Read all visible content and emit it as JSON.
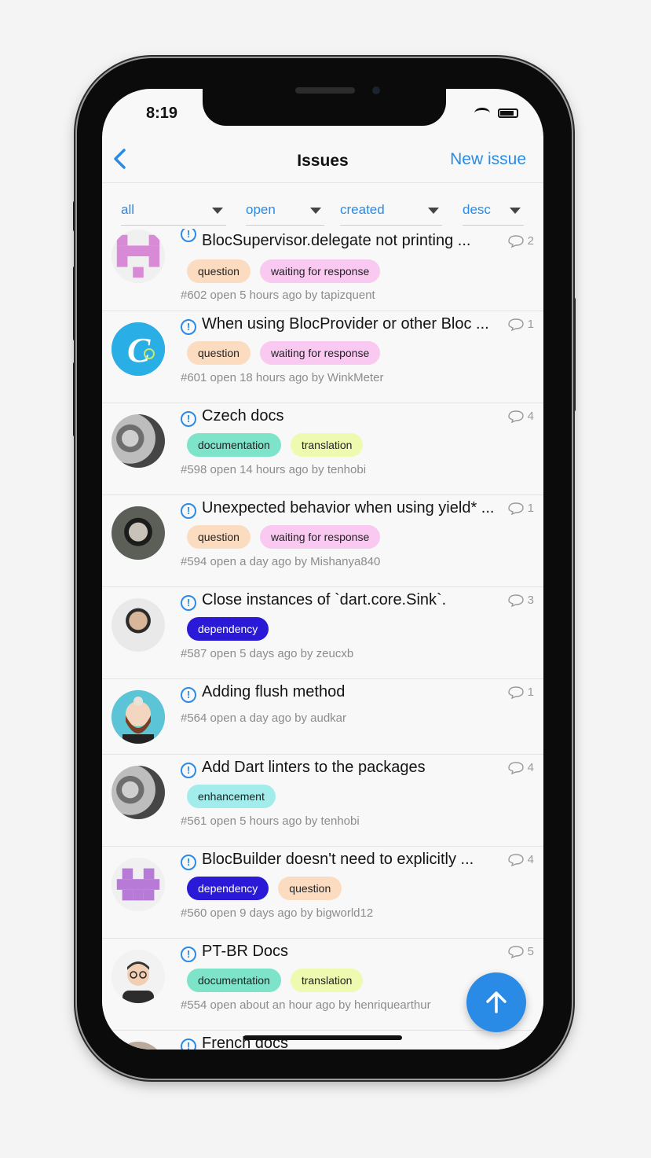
{
  "status": {
    "time": "8:19"
  },
  "navbar": {
    "title": "Issues",
    "new_issue_label": "New issue"
  },
  "filters": [
    {
      "label": "all"
    },
    {
      "label": "open"
    },
    {
      "label": "created"
    },
    {
      "label": "desc"
    }
  ],
  "colors": {
    "accent": "#2a8be6",
    "question": "#fcdcc0",
    "waiting": "#f9c9f1",
    "documentation": "#7de3c9",
    "translation": "#eefab0",
    "dependency": "#2a1ad8",
    "enhancement": "#a3ecec"
  },
  "issues": [
    {
      "title": "BlocSupervisor.delegate not printing ...",
      "comments": "2",
      "labels": [
        {
          "text": "question",
          "type": "question"
        },
        {
          "text": "waiting for response",
          "type": "waiting"
        }
      ],
      "meta": "#602 open 5 hours ago by tapizquent",
      "avatar": "pink-identicon"
    },
    {
      "title": "When using BlocProvider or other Bloc ...",
      "comments": "1",
      "labels": [
        {
          "text": "question",
          "type": "question"
        },
        {
          "text": "waiting for response",
          "type": "waiting"
        }
      ],
      "meta": "#601 open 18 hours ago by WinkMeter",
      "avatar": "letter-c-logo"
    },
    {
      "title": "Czech docs",
      "comments": "4",
      "labels": [
        {
          "text": "documentation",
          "type": "documentation"
        },
        {
          "text": "translation",
          "type": "translation"
        }
      ],
      "meta": "#598 open 14 hours ago by tenhobi",
      "avatar": "couple-photo"
    },
    {
      "title": "Unexpected behavior when using yield* ...",
      "comments": "1",
      "labels": [
        {
          "text": "question",
          "type": "question"
        },
        {
          "text": "waiting for response",
          "type": "waiting"
        }
      ],
      "meta": "#594 open a day ago by Mishanya840",
      "avatar": "headphones-photo"
    },
    {
      "title": "Close instances of `dart.core.Sink`.",
      "comments": "3",
      "labels": [
        {
          "text": "dependency",
          "type": "dependency"
        }
      ],
      "meta": "#587 open 5 days ago by zeucxb",
      "avatar": "glasses-photo"
    },
    {
      "title": "Adding flush method",
      "comments": "1",
      "labels": [],
      "meta": "#564 open a day ago by audkar",
      "avatar": "bearded-cartoon"
    },
    {
      "title": "Add Dart linters to the packages",
      "comments": "4",
      "labels": [
        {
          "text": "enhancement",
          "type": "enhancement"
        }
      ],
      "meta": "#561 open 5 hours ago by tenhobi",
      "avatar": "couple-photo"
    },
    {
      "title": "BlocBuilder doesn't need to explicitly ...",
      "comments": "4",
      "labels": [
        {
          "text": "dependency",
          "type": "dependency"
        },
        {
          "text": "question",
          "type": "question"
        }
      ],
      "meta": "#560 open 9 days ago by bigworld12",
      "avatar": "purple-identicon"
    },
    {
      "title": "PT-BR Docs",
      "comments": "5",
      "labels": [
        {
          "text": "documentation",
          "type": "documentation"
        },
        {
          "text": "translation",
          "type": "translation"
        }
      ],
      "meta": "#554 open about an hour ago by henriquearthur",
      "avatar": "cartoon-man"
    },
    {
      "title": "French docs",
      "comments": "",
      "labels": [],
      "meta": "",
      "avatar": "photo"
    }
  ]
}
